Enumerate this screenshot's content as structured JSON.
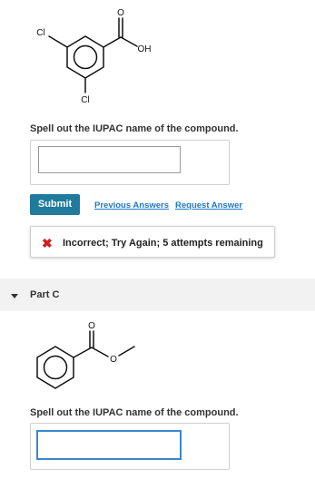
{
  "part_b": {
    "structure": {
      "atoms": {
        "cl_top": "Cl",
        "oh": "OH",
        "o_double": "O",
        "cl_bottom": "Cl"
      }
    },
    "prompt": "Spell out the IUPAC name of the compound.",
    "answer": {
      "value": "",
      "placeholder": ""
    },
    "actions": {
      "submit_label": "Submit",
      "previous_answers_label": "Previous Answers",
      "request_answer_label": "Request Answer"
    },
    "feedback": {
      "icon": "x-icon",
      "message": "Incorrect; Try Again; 5 attempts remaining",
      "color": "#d0201e"
    }
  },
  "part_c": {
    "header": {
      "label": "Part C",
      "toggle_icon": "caret-down-icon"
    },
    "structure": {
      "atoms": {
        "o_double": "O",
        "o_ester": "O"
      }
    },
    "prompt": "Spell out the IUPAC name of the compound.",
    "answer": {
      "value": "",
      "placeholder": ""
    }
  },
  "colors": {
    "submit_bg": "#1f7a9c",
    "link": "#1f77c6",
    "input_focus": "#3b86d1"
  }
}
